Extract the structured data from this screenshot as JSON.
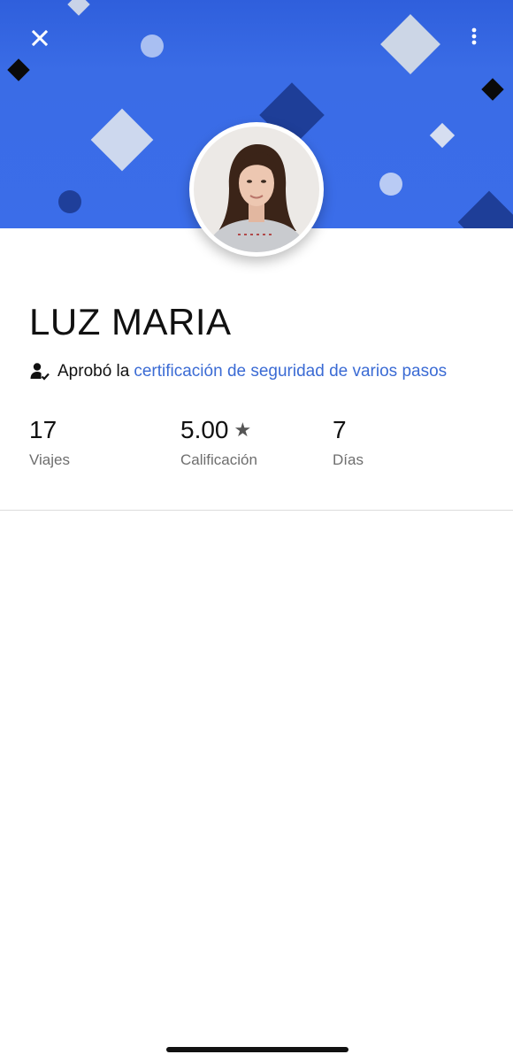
{
  "header": {
    "close_icon": "close-icon",
    "more_icon": "more-vertical-icon",
    "background_color": "#3b6de9"
  },
  "profile": {
    "name": "LUZ MARIA",
    "avatar_icon": "profile-photo"
  },
  "certification": {
    "icon": "verified-user-icon",
    "prefix": "Aprobó la",
    "link_text": "certificación de seguridad de varios pasos",
    "link_color": "#3b6bd4"
  },
  "stats": [
    {
      "value": "17",
      "label": "Viajes"
    },
    {
      "value": "5.00",
      "star": "★",
      "label": "Calificación"
    },
    {
      "value": "7",
      "label": "Días"
    }
  ]
}
